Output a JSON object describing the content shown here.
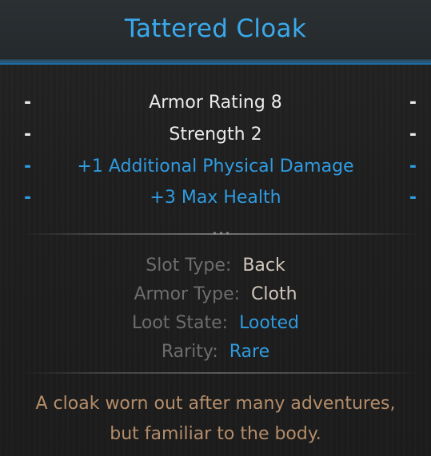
{
  "item": {
    "name": "Tattered Cloak"
  },
  "stats": [
    {
      "text": "Armor Rating 8",
      "color": "#e9e9e9",
      "dash": "-"
    },
    {
      "text": "Strength 2",
      "color": "#e9e9e9",
      "dash": "-"
    },
    {
      "text": "+1 Additional Physical Damage",
      "color": "#2f9be0",
      "dash": "-"
    },
    {
      "text": "+3 Max Health",
      "color": "#2f9be0",
      "dash": "-"
    }
  ],
  "divider_dots": "•••",
  "properties": [
    {
      "label": "Slot Type:",
      "value": "Back",
      "value_color": "#cfc7bc"
    },
    {
      "label": "Armor Type:",
      "value": "Cloth",
      "value_color": "#cfc7bc"
    },
    {
      "label": "Loot State:",
      "value": "Looted",
      "value_color": "#2f9be0"
    },
    {
      "label": "Rarity:",
      "value": "Rare",
      "value_color": "#2f9be0"
    }
  ],
  "description": {
    "line1": "A cloak worn out after many adventures,",
    "line2": "but familiar to the body."
  },
  "colors": {
    "title": "#3aa9ec",
    "header_line": "#1c6ea6",
    "label": "#6d6d6d",
    "description": "#b48d6a"
  }
}
